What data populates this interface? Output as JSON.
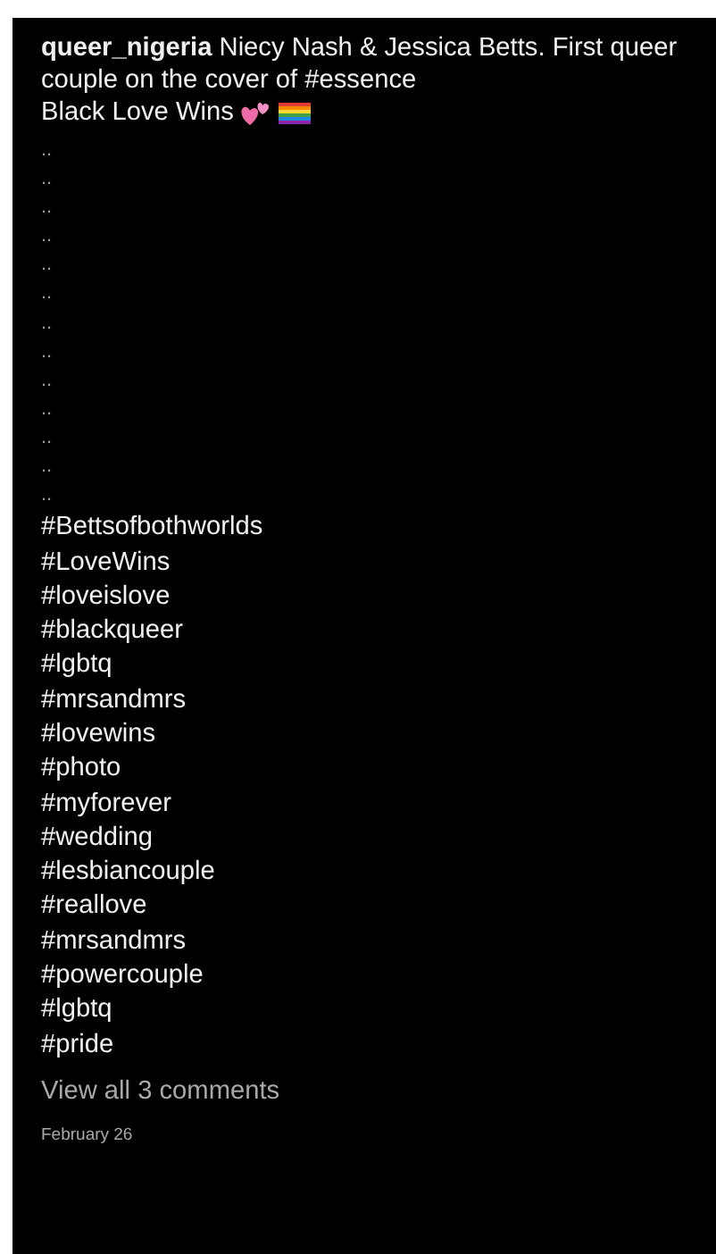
{
  "caption": {
    "text": "**queer_nigeria** Niecy Nash & Jessica Betts. First queer couple on the cover of #essence",
    "second_line": "Black Love Wins"
  },
  "dot_lines": [
    "..",
    "..",
    "..",
    "..",
    "..",
    "..",
    "..",
    "..",
    "..",
    "..",
    "..",
    "..",
    ".."
  ],
  "hashtags": [
    "#Bettsofbothworlds",
    "#LoveWins",
    "#loveislove",
    "#blackqueer",
    "#lgbtq",
    "#mrsandmrs",
    "#lovewins",
    "#photo",
    "#myforever",
    "#wedding",
    "#lesbiancouple",
    "#reallove",
    "#mrsandmrs",
    "#powercouple",
    "#lgbtq",
    "#pride"
  ],
  "comments_link": "View all 3 comments",
  "date": "February 26"
}
